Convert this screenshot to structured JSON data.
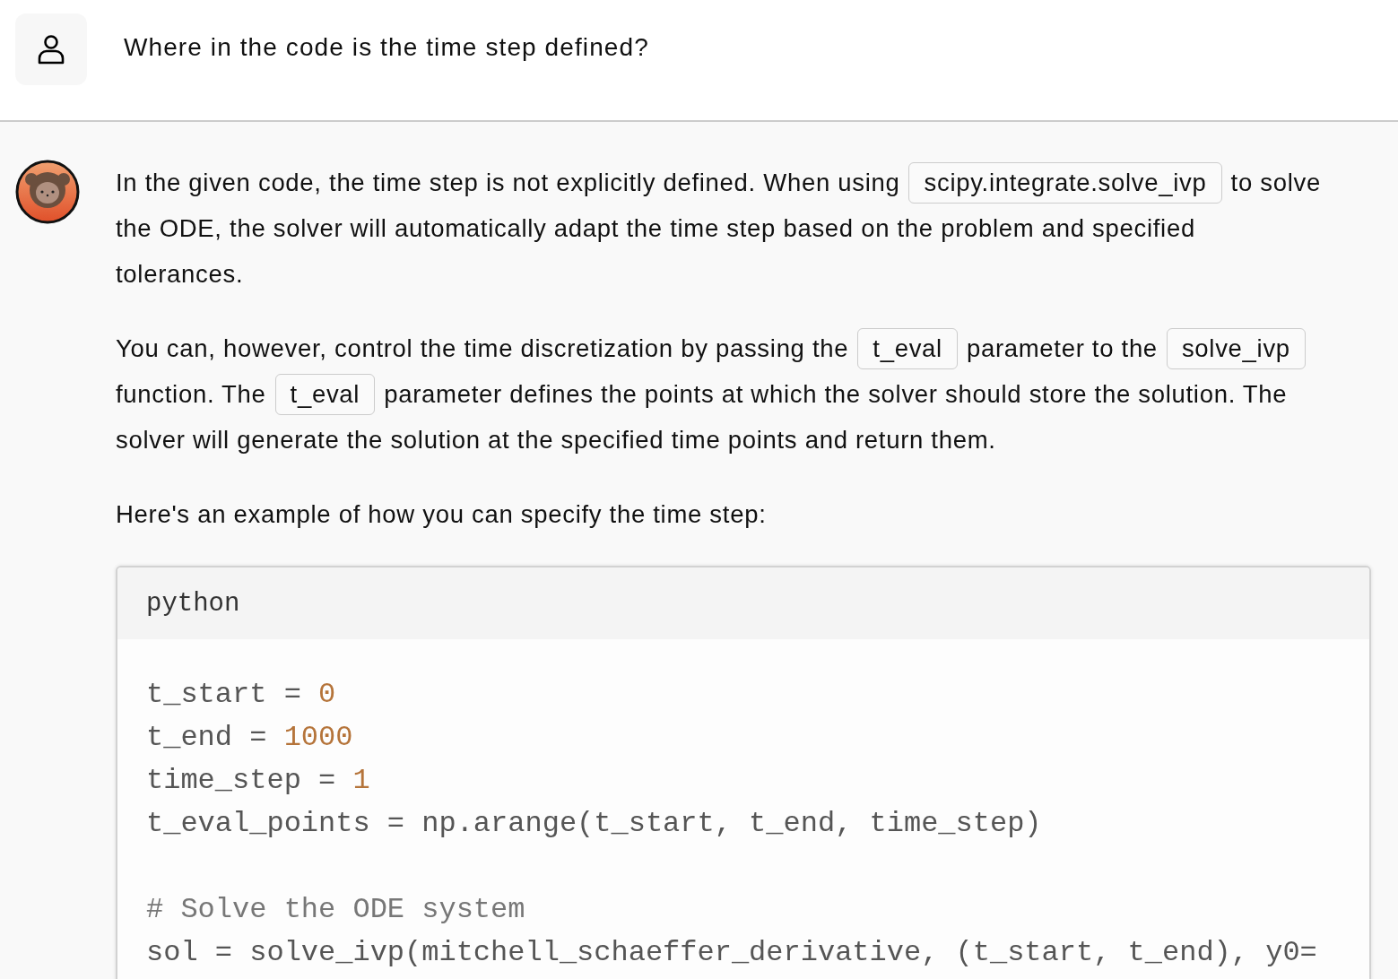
{
  "question": {
    "text": "Where in the code is the time step defined?"
  },
  "answer": {
    "paragraphs": [
      [
        [
          {
            "kind": "text",
            "text": "In the given code, the time step is not explicitly defined. When using"
          },
          {
            "kind": "code",
            "text": "scipy.integrate.solve_ivp"
          },
          {
            "kind": "text",
            "text": "to solve"
          }
        ],
        [
          {
            "kind": "text",
            "text": "the ODE, the solver will automatically adapt the time step based on the problem and specified"
          }
        ],
        [
          {
            "kind": "text",
            "text": "tolerances."
          }
        ]
      ],
      [
        [
          {
            "kind": "text",
            "text": "You can, however, control the time discretization by passing the"
          },
          {
            "kind": "code",
            "text": "t_eval"
          },
          {
            "kind": "text",
            "text": "parameter to the"
          },
          {
            "kind": "code",
            "text": "solve_ivp"
          }
        ],
        [
          {
            "kind": "text",
            "text": "function. The"
          },
          {
            "kind": "code",
            "text": "t_eval"
          },
          {
            "kind": "text",
            "text": "parameter defines the points at which the solver should store the solution. The"
          }
        ],
        [
          {
            "kind": "text",
            "text": "solver will generate the solution at the specified time points and return them."
          }
        ]
      ],
      [
        [
          {
            "kind": "text",
            "text": "Here's an example of how you can specify the time step:"
          }
        ]
      ]
    ],
    "code_block": {
      "language": "python",
      "blocks": [
        [
          [
            {
              "kind": "plain",
              "text": "t_start = "
            },
            {
              "kind": "number",
              "text": "0"
            }
          ],
          [
            {
              "kind": "plain",
              "text": "t_end = "
            },
            {
              "kind": "number",
              "text": "1000"
            }
          ],
          [
            {
              "kind": "plain",
              "text": "time_step = "
            },
            {
              "kind": "number",
              "text": "1"
            }
          ],
          [
            {
              "kind": "plain",
              "text": "t_eval_points = np.arange(t_start, t_end, time_step)"
            }
          ]
        ],
        [
          [
            {
              "kind": "comment",
              "text": "# Solve the ODE system"
            }
          ],
          [
            {
              "kind": "plain",
              "text": "sol = solve_ivp(mitchell_schaeffer_derivative, (t_start, t_end), y0="
            }
          ]
        ]
      ]
    }
  }
}
